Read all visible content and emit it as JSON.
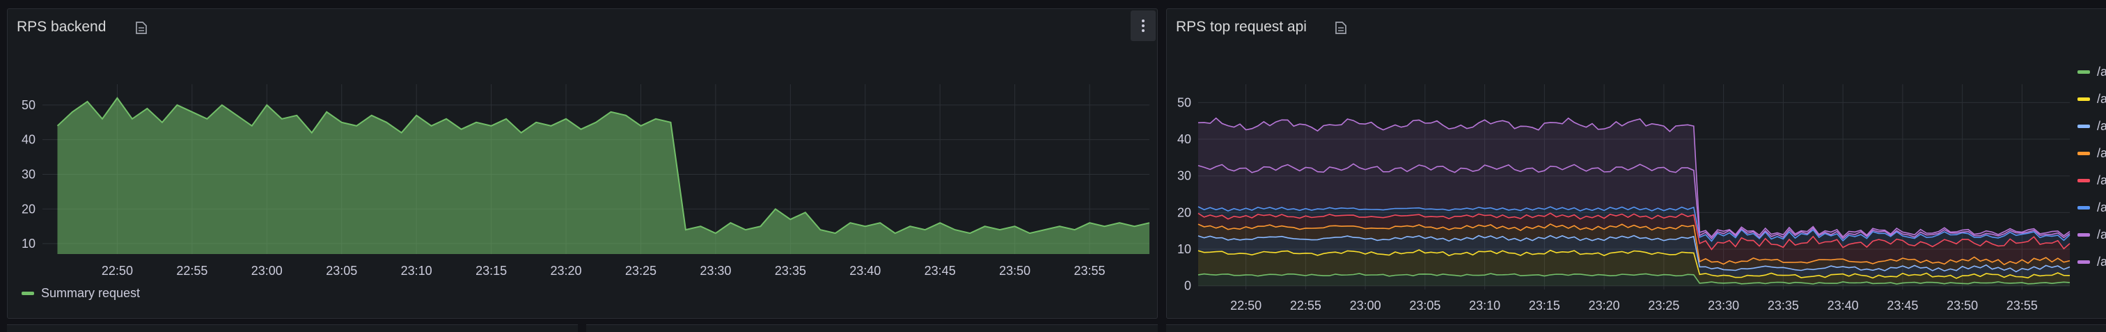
{
  "panels": {
    "left": {
      "title": "RPS backend"
    },
    "right": {
      "title": "RPS top request api"
    }
  },
  "icons": {
    "panel_info": "panel-info-icon",
    "menu": "kebab-menu-icon"
  },
  "colors": {
    "background": "#111217",
    "panel": "#181b1f",
    "green": "#73bf69",
    "yellow": "#fade2a",
    "blue": "#5794f2",
    "orange": "#ff9830",
    "red": "#f2495c",
    "light_blue": "#8ab8ff",
    "purple": "#b877d9"
  },
  "chart_data": [
    {
      "type": "area",
      "title": "RPS backend",
      "xlabel": "",
      "ylabel": "",
      "x_ticks": [
        "22:50",
        "22:55",
        "23:00",
        "23:05",
        "23:10",
        "23:15",
        "23:20",
        "23:25",
        "23:30",
        "23:35",
        "23:40",
        "23:45",
        "23:50",
        "23:55"
      ],
      "y_ticks": [
        "10",
        "20",
        "30",
        "40",
        "50"
      ],
      "ylim": [
        7,
        56
      ],
      "x_range": [
        "22:45",
        "23:59"
      ],
      "grid": true,
      "legend": "bottom-left",
      "series": [
        {
          "name": "Summary request",
          "color": "#73bf69",
          "points": [
            [
              "22:46",
              44
            ],
            [
              "22:47",
              48
            ],
            [
              "22:48",
              51
            ],
            [
              "22:49",
              46
            ],
            [
              "22:50",
              52
            ],
            [
              "22:51",
              46
            ],
            [
              "22:52",
              49
            ],
            [
              "22:53",
              45
            ],
            [
              "22:54",
              50
            ],
            [
              "22:55",
              48
            ],
            [
              "22:56",
              46
            ],
            [
              "22:57",
              50
            ],
            [
              "22:58",
              47
            ],
            [
              "22:59",
              44
            ],
            [
              "23:00",
              50
            ],
            [
              "23:01",
              46
            ],
            [
              "23:02",
              47
            ],
            [
              "23:03",
              42
            ],
            [
              "23:04",
              48
            ],
            [
              "23:05",
              45
            ],
            [
              "23:06",
              44
            ],
            [
              "23:07",
              47
            ],
            [
              "23:08",
              45
            ],
            [
              "23:09",
              42
            ],
            [
              "23:10",
              47
            ],
            [
              "23:11",
              44
            ],
            [
              "23:12",
              46
            ],
            [
              "23:13",
              43
            ],
            [
              "23:14",
              45
            ],
            [
              "23:15",
              44
            ],
            [
              "23:16",
              46
            ],
            [
              "23:17",
              42
            ],
            [
              "23:18",
              45
            ],
            [
              "23:19",
              44
            ],
            [
              "23:20",
              46
            ],
            [
              "23:21",
              43
            ],
            [
              "23:22",
              45
            ],
            [
              "23:23",
              48
            ],
            [
              "23:24",
              47
            ],
            [
              "23:25",
              44
            ],
            [
              "23:26",
              46
            ],
            [
              "23:27",
              45
            ],
            [
              "23:28",
              14
            ],
            [
              "23:29",
              15
            ],
            [
              "23:30",
              13
            ],
            [
              "23:31",
              16
            ],
            [
              "23:32",
              14
            ],
            [
              "23:33",
              15
            ],
            [
              "23:34",
              20
            ],
            [
              "23:35",
              17
            ],
            [
              "23:36",
              19
            ],
            [
              "23:37",
              14
            ],
            [
              "23:38",
              13
            ],
            [
              "23:39",
              16
            ],
            [
              "23:40",
              15
            ],
            [
              "23:41",
              16
            ],
            [
              "23:42",
              13
            ],
            [
              "23:43",
              15
            ],
            [
              "23:44",
              14
            ],
            [
              "23:45",
              16
            ],
            [
              "23:46",
              14
            ],
            [
              "23:47",
              13
            ],
            [
              "23:48",
              15
            ],
            [
              "23:49",
              14
            ],
            [
              "23:50",
              15
            ],
            [
              "23:51",
              13
            ],
            [
              "23:52",
              14
            ],
            [
              "23:53",
              15
            ],
            [
              "23:54",
              14
            ],
            [
              "23:55",
              16
            ],
            [
              "23:56",
              15
            ],
            [
              "23:57",
              16
            ],
            [
              "23:58",
              15
            ],
            [
              "23:59",
              16
            ]
          ]
        }
      ]
    },
    {
      "type": "area",
      "title": "RPS top request api",
      "xlabel": "",
      "ylabel": "",
      "x_ticks": [
        "22:50",
        "22:55",
        "23:00",
        "23:05",
        "23:10",
        "23:15",
        "23:20",
        "23:25",
        "23:30",
        "23:35",
        "23:40",
        "23:45",
        "23:50",
        "23:55"
      ],
      "y_ticks": [
        "0",
        "10",
        "20",
        "30",
        "40",
        "50"
      ],
      "ylim": [
        -1,
        55
      ],
      "x_range": [
        "22:46",
        "23:59"
      ],
      "grid": true,
      "legend": "right",
      "stacked": true,
      "series": [
        {
          "name": "/a",
          "color": "#73bf69",
          "values_before": 3,
          "values_after": 0.8
        },
        {
          "name": "/a",
          "color": "#fade2a",
          "values_before": 6,
          "values_after": 2
        },
        {
          "name": "/a",
          "color": "#8ab8ff",
          "values_before": 4,
          "values_after": 2
        },
        {
          "name": "/a",
          "color": "#ff9830",
          "values_before": 3,
          "values_after": 2
        },
        {
          "name": "/a",
          "color": "#f2495c",
          "values_before": 3,
          "values_after": 5
        },
        {
          "name": "/a",
          "color": "#5794f2",
          "values_before": 2,
          "values_after": 2
        },
        {
          "name": "/a",
          "color": "#b877d9",
          "values_before": 11,
          "values_after": 0.5
        },
        {
          "name": "/a",
          "color": "#b877d9",
          "values_before": 12,
          "values_after": 0.5
        }
      ]
    }
  ],
  "legend_right": {
    "items": [
      {
        "label": "/a",
        "color": "#73bf69"
      },
      {
        "label": "/a",
        "color": "#fade2a"
      },
      {
        "label": "/a",
        "color": "#8ab8ff"
      },
      {
        "label": "/a",
        "color": "#ff9830"
      },
      {
        "label": "/a",
        "color": "#f2495c"
      },
      {
        "label": "/a",
        "color": "#5794f2"
      },
      {
        "label": "/a",
        "color": "#b877d9"
      },
      {
        "label": "/a",
        "color": "#b877d9"
      }
    ]
  }
}
